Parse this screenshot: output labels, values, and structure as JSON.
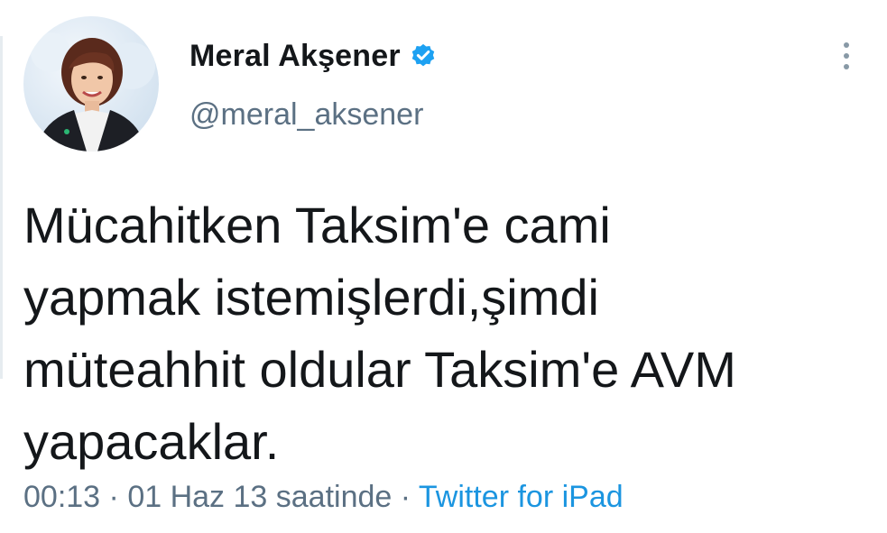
{
  "user": {
    "display_name": "Meral Akşener",
    "handle": "@meral_aksener",
    "verified": true,
    "verified_icon": "verified-badge-icon",
    "avatar": "profile-avatar"
  },
  "tweet": {
    "text": "Mücahitken Taksim'e cami\nyapmak istemişlerdi,şimdi\nmüteahhit oldular Taksim'e AVM\nyapacaklar."
  },
  "meta": {
    "time": "00:13",
    "separator1": " · ",
    "date": "01 Haz 13 saatinde",
    "separator2": " · ",
    "source": "Twitter for iPad"
  },
  "menu": {
    "icon": "more-vertical-icon"
  },
  "colors": {
    "text": "#14171a",
    "secondary": "#5b7083",
    "link": "#1b95e0",
    "verified": "#1da1f2"
  }
}
